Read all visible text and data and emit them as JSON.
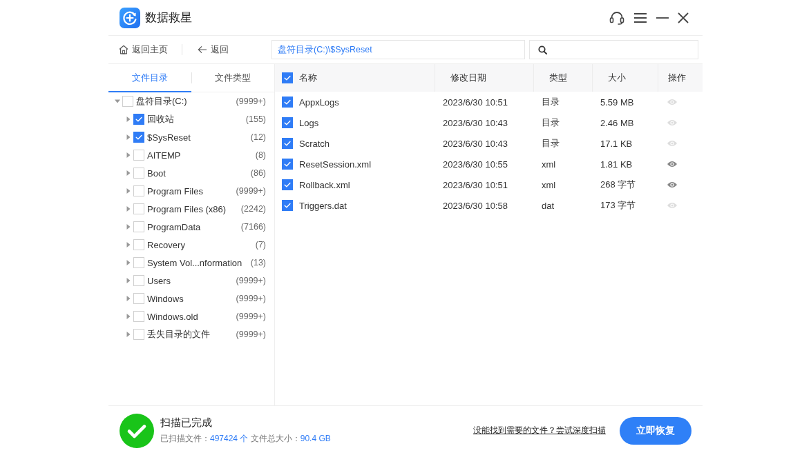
{
  "window": {
    "title": "数据救星"
  },
  "toolbar": {
    "home_button": "返回主页",
    "back_button": "返回",
    "path": "盘符目录(C:)\\$SysReset"
  },
  "sidebar": {
    "tabs": [
      {
        "label": "文件目录",
        "selected": true
      },
      {
        "label": "文件类型",
        "selected": false
      }
    ],
    "tree": [
      {
        "name": "盘符目录(C:)",
        "count": "(9999+)",
        "checked": false,
        "expanded": true,
        "children": [
          {
            "name": "回收站",
            "count": "(155)",
            "checked": true,
            "expanded": false
          },
          {
            "name": "$SysReset",
            "count": "(12)",
            "checked": true,
            "expanded": false
          },
          {
            "name": "AITEMP",
            "count": "(8)",
            "checked": false,
            "expanded": false
          },
          {
            "name": "Boot",
            "count": "(86)",
            "checked": false,
            "expanded": false
          },
          {
            "name": "Program Files",
            "count": "(9999+)",
            "checked": false,
            "expanded": false
          },
          {
            "name": "Program Files (x86)",
            "count": "(2242)",
            "checked": false,
            "expanded": false
          },
          {
            "name": "ProgramData",
            "count": "(7166)",
            "checked": false,
            "expanded": false
          },
          {
            "name": "Recovery",
            "count": "(7)",
            "checked": false,
            "expanded": false
          },
          {
            "name": "System Vol...nformation",
            "count": "(13)",
            "checked": false,
            "expanded": false
          },
          {
            "name": "Users",
            "count": "(9999+)",
            "checked": false,
            "expanded": false
          },
          {
            "name": "Windows",
            "count": "(9999+)",
            "checked": false,
            "expanded": false
          },
          {
            "name": "Windows.old",
            "count": "(9999+)",
            "checked": false,
            "expanded": false
          },
          {
            "name": "丢失目录的文件",
            "count": "(9999+)",
            "checked": false,
            "expanded": false
          }
        ]
      }
    ]
  },
  "table": {
    "all_checked": true,
    "columns": [
      "名称",
      "修改日期",
      "类型",
      "大小",
      "操作"
    ],
    "rows": [
      {
        "name": "AppxLogs",
        "modified": "2023/6/30 10:51",
        "type": "目录",
        "size": "5.59 MB",
        "checked": true,
        "previewable": false
      },
      {
        "name": "Logs",
        "modified": "2023/6/30 10:43",
        "type": "目录",
        "size": "2.46 MB",
        "checked": true,
        "previewable": false
      },
      {
        "name": "Scratch",
        "modified": "2023/6/30 10:43",
        "type": "目录",
        "size": "17.1 KB",
        "checked": true,
        "previewable": false
      },
      {
        "name": "ResetSession.xml",
        "modified": "2023/6/30 10:55",
        "type": "xml",
        "size": "1.81 KB",
        "checked": true,
        "previewable": true
      },
      {
        "name": "Rollback.xml",
        "modified": "2023/6/30 10:51",
        "type": "xml",
        "size": "268 字节",
        "checked": true,
        "previewable": true
      },
      {
        "name": "Triggers.dat",
        "modified": "2023/6/30 10:58",
        "type": "dat",
        "size": "173 字节",
        "checked": true,
        "previewable": false
      }
    ]
  },
  "footer": {
    "status": "扫描已完成",
    "scanned_label": "已扫描文件：",
    "scanned_count": "497424 个",
    "size_label": "文件总大小：",
    "size_value": "90.4 GB",
    "deep_scan_link": "没能找到需要的文件？尝试深度扫描",
    "recover_button": "立即恢复"
  }
}
